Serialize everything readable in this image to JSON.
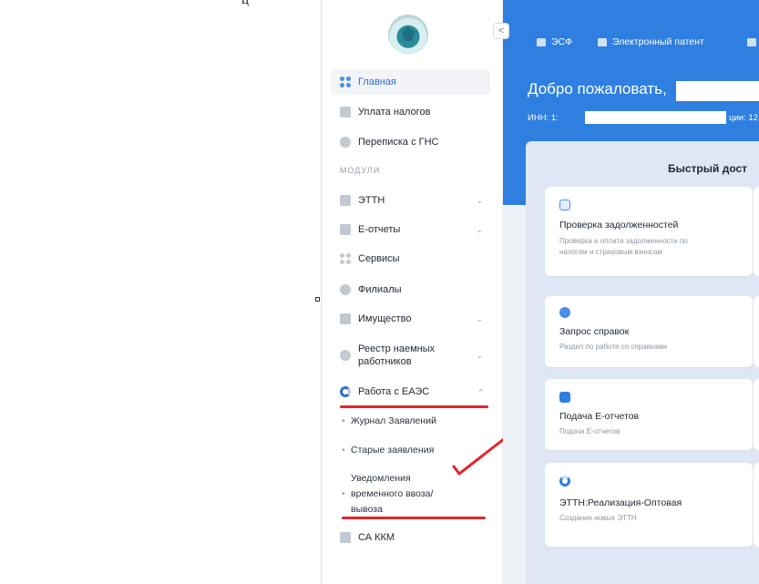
{
  "sidebar": {
    "collapse_label": "<",
    "main_items": [
      {
        "label": "Главная",
        "icon": "dashboard-icon",
        "active": true
      },
      {
        "label": "Уплата налогов",
        "icon": "tax-payment-icon"
      },
      {
        "label": "Переписка с ГНС",
        "icon": "correspondence-icon"
      }
    ],
    "section_label": "МОДУЛИ",
    "modules": [
      {
        "label": "ЭТТН",
        "icon": "cart-icon",
        "chevron": "⌄"
      },
      {
        "label": "Е-отчеты",
        "icon": "report-icon",
        "chevron": "⌄"
      },
      {
        "label": "Сервисы",
        "icon": "services-icon"
      },
      {
        "label": "Филиалы",
        "icon": "branch-icon"
      },
      {
        "label": "Имущество",
        "icon": "property-icon",
        "chevron": "⌄"
      },
      {
        "label": "Реестр наемных работников",
        "icon": "employees-icon",
        "chevron": "⌄"
      },
      {
        "label": "Работа с ЕАЭС",
        "icon": "eaeu-icon",
        "chevron": "^"
      }
    ],
    "sub_items": [
      {
        "label": "Журнал Заявлений"
      },
      {
        "label": "Старые заявления"
      },
      {
        "label": "Уведомления временного ввоза/ вывоза"
      }
    ],
    "last_item": {
      "label": "СА ККМ",
      "icon": "cash-register-icon"
    },
    "bullet": "•"
  },
  "topbar": {
    "links": [
      {
        "label": "ЭСФ",
        "icon": "invoice-icon"
      },
      {
        "label": "Электронный патент",
        "icon": "patent-icon"
      }
    ],
    "welcome": "Добро пожаловать,",
    "inn_label": "ИНН: 1:",
    "inn_tail": "ции: 12"
  },
  "quick_access": {
    "title": "Быстрый дост",
    "cards": [
      {
        "title": "Проверка задолженностей",
        "description": "Проверка и оплата задолженности по налогам и страховым взносам",
        "icon": "search-document-icon"
      },
      {
        "title": "Запрос справок",
        "description": "Раздел по работе со справками",
        "icon": "certificate-icon"
      },
      {
        "title": "Подача Е-отчетов",
        "description": "Подача Е-отчетов",
        "icon": "upload-folder-icon"
      },
      {
        "title": "ЭТТН:Реализация-Оптовая",
        "description": "Создание новых ЭТТН",
        "icon": "progress-ring-icon"
      }
    ]
  },
  "colors": {
    "accent": "#2f7fe0",
    "active_text": "#2f6fd6",
    "annotation_red": "#e0262b"
  }
}
